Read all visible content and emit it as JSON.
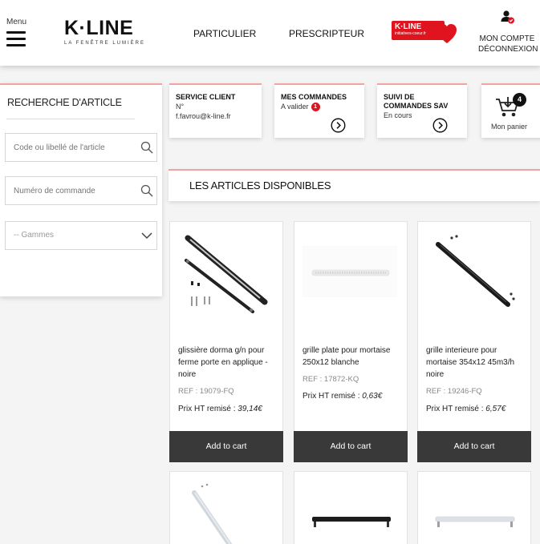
{
  "header": {
    "menu_label": "Menu",
    "logo_text": "K·LINE",
    "logo_tagline": "LA FENÊTRE LUMIÈRE",
    "nav": [
      {
        "label": "PARTICULIER"
      },
      {
        "label": "PRESCRIPTEUR"
      }
    ],
    "partner_logo": {
      "title": "K·LINE",
      "subtitle": "initiatives-coeur.fr"
    },
    "account_label": "MON COMPTE",
    "logout_label": "DÉCONNEXION"
  },
  "sidebar": {
    "title": "RECHERCHE D'ARTICLE",
    "search_placeholder": "Code ou libellé de l'article",
    "order_placeholder": "Numéro de commande",
    "range_select_value": "-- Gammes"
  },
  "cards": {
    "service": {
      "title": "SERVICE CLIENT",
      "line1": "N°",
      "line2": "f.favrou@k-line.fr"
    },
    "orders": {
      "title": "MES COMMANDES",
      "line1": "A valider",
      "badge": "1"
    },
    "sav": {
      "title_1": "SUIVI DE",
      "title_2": "COMMANDES SAV",
      "line1": "En cours"
    },
    "cart": {
      "label": "Mon panier",
      "count": "4"
    }
  },
  "section_title": "LES ARTICLES DISPONIBLES",
  "products": [
    {
      "name": "glissière dorma g/n pour ferme porte en applique - noire",
      "ref": "REF : 19079-FQ",
      "price_label": "Prix HT remisé :",
      "price": "39,14€",
      "button": "Add to cart"
    },
    {
      "name": "grille plate pour mortaise 250x12 blanche",
      "ref": "REF : 17872-KQ",
      "price_label": "Prix HT remisé :",
      "price": "0,63€",
      "button": "Add to cart"
    },
    {
      "name": "grille interieure pour mortaise 354x12 45m3/h noire",
      "ref": "REF : 19246-FQ",
      "price_label": "Prix HT remisé :",
      "price": "6,57€",
      "button": "Add to cart"
    }
  ],
  "colors": {
    "accent_red": "#e0141e",
    "button_dark": "#393939",
    "card_border": "#f0a3a3"
  },
  "icons": [
    "menu-icon",
    "account-icon",
    "search-icon",
    "chevron-down-icon",
    "arrow-right-circle-icon",
    "cart-icon"
  ]
}
